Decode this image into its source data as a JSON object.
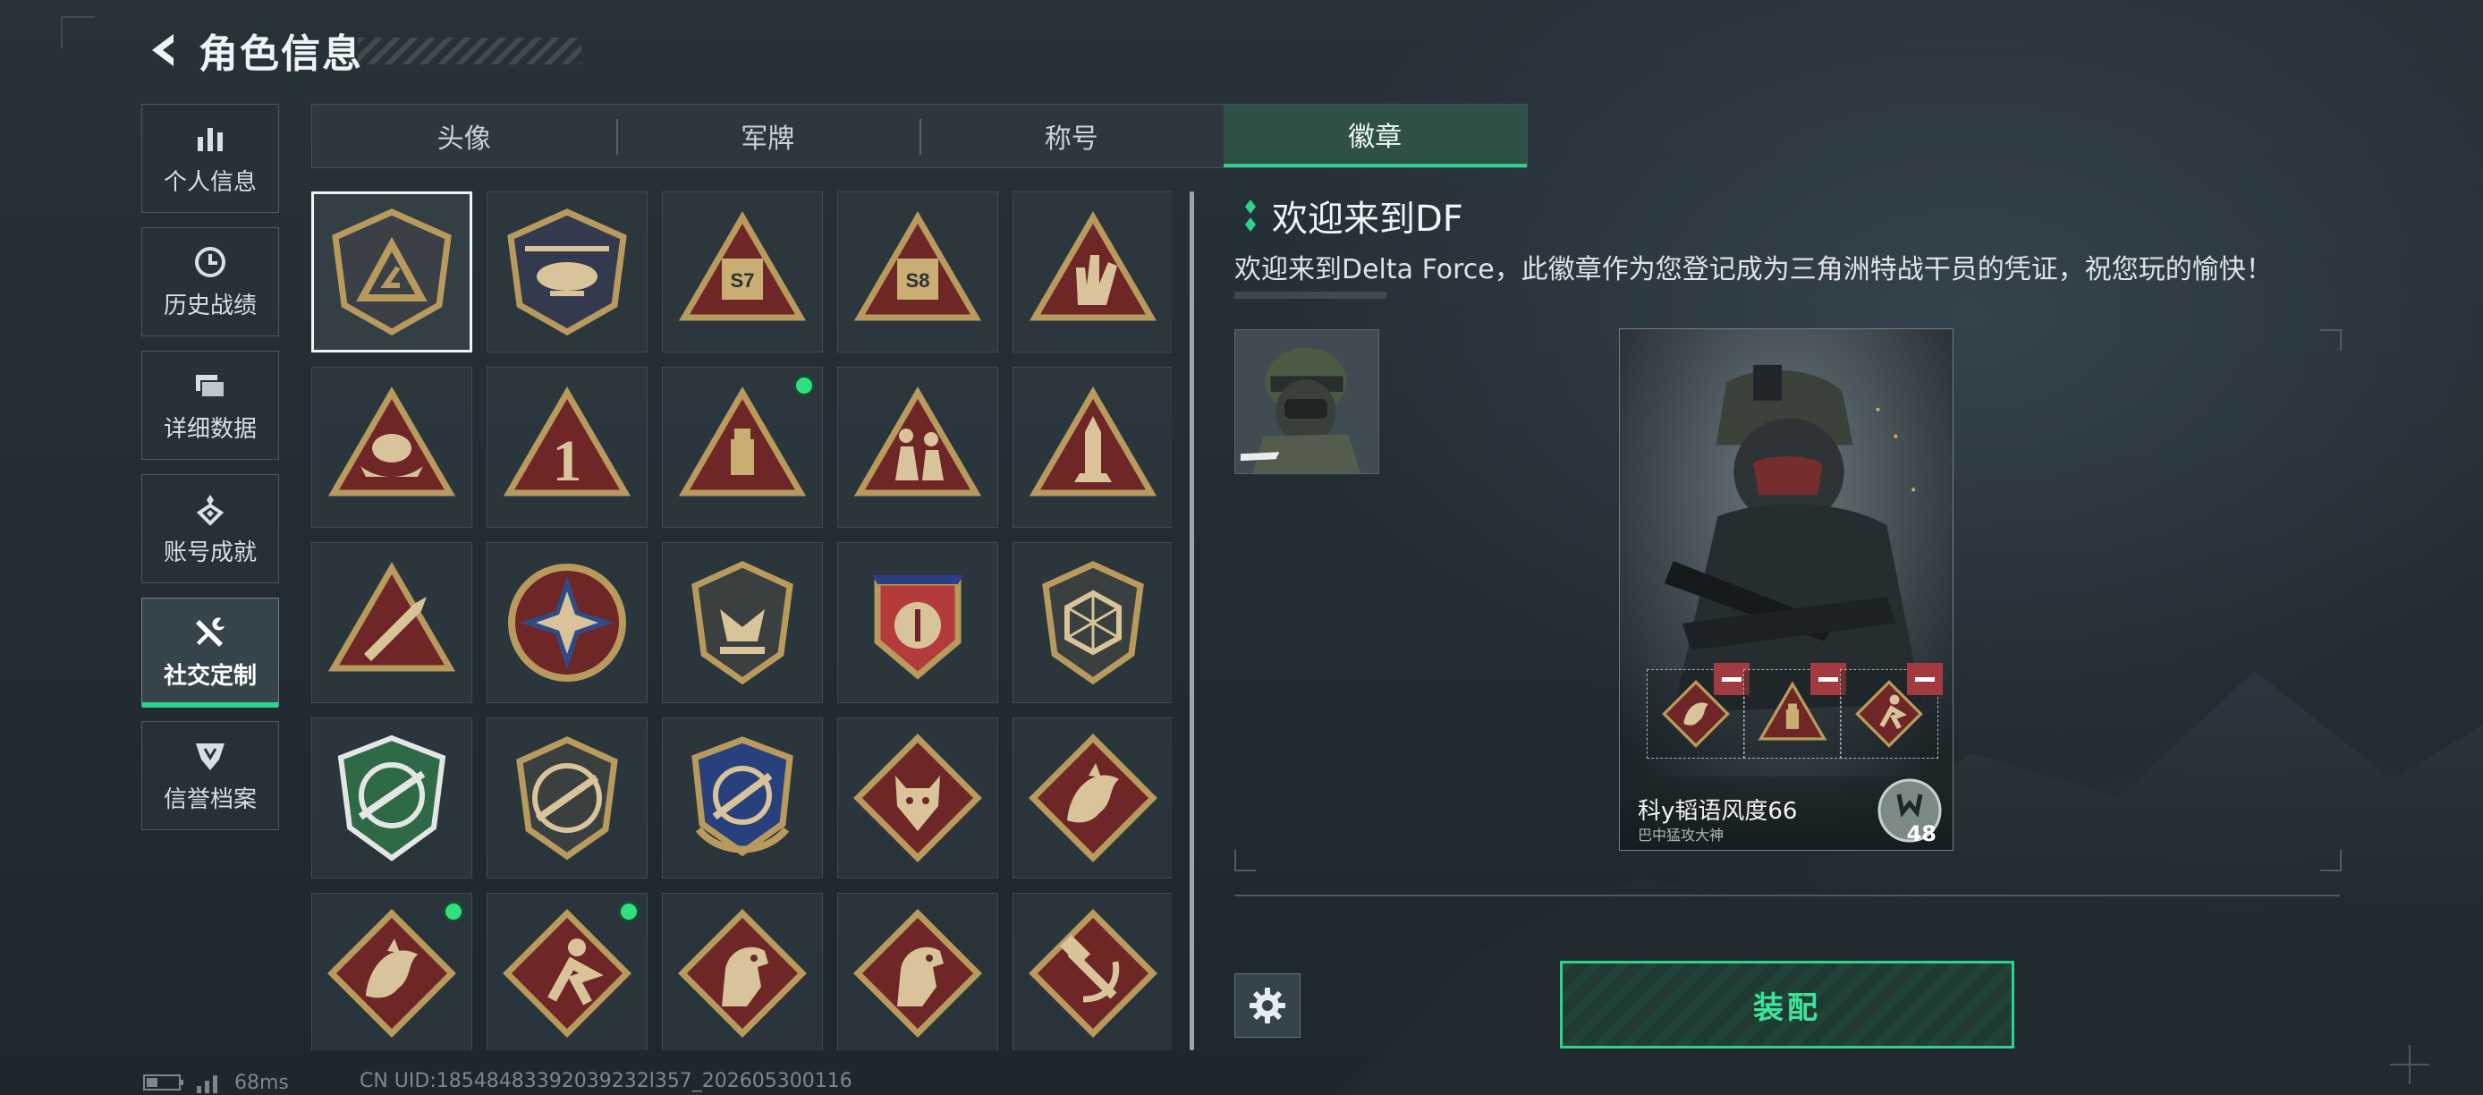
{
  "header": {
    "title": "角色信息",
    "back_icon": "chevron-left-icon"
  },
  "sidebar": {
    "items": [
      {
        "label": "个人信息",
        "icon": "bar-chart-icon",
        "active": false
      },
      {
        "label": "历史战绩",
        "icon": "history-clock-icon",
        "active": false
      },
      {
        "label": "详细数据",
        "icon": "folder-stack-icon",
        "active": false
      },
      {
        "label": "账号成就",
        "icon": "achievement-medal-icon",
        "active": false
      },
      {
        "label": "社交定制",
        "icon": "wrench-screwdriver-icon",
        "active": true
      },
      {
        "label": "信誉档案",
        "icon": "reputation-shield-icon",
        "active": false
      }
    ]
  },
  "tabs": [
    {
      "label": "头像",
      "active": false
    },
    {
      "label": "军牌",
      "active": false
    },
    {
      "label": "称号",
      "active": false
    },
    {
      "label": "徽章",
      "active": true
    }
  ],
  "badges": [
    {
      "icon": "delta-shield-badge-icon",
      "selected": true,
      "is_new": false
    },
    {
      "icon": "helicopter-badge-icon",
      "selected": false,
      "is_new": false
    },
    {
      "icon": "s7-triangle-badge-icon",
      "selected": false,
      "is_new": false,
      "text": "S7"
    },
    {
      "icon": "s8-triangle-badge-icon",
      "selected": false,
      "is_new": false,
      "text": "S8"
    },
    {
      "icon": "hand-sign-badge-icon",
      "selected": false,
      "is_new": false
    },
    {
      "icon": "boat-triangle-badge-icon",
      "selected": false,
      "is_new": false
    },
    {
      "icon": "number-one-badge-icon",
      "selected": false,
      "is_new": false,
      "text": "1"
    },
    {
      "icon": "usb-triangle-badge-icon",
      "selected": false,
      "is_new": true
    },
    {
      "icon": "soldiers-triangle-badge-icon",
      "selected": false,
      "is_new": false
    },
    {
      "icon": "rocket-triangle-badge-icon",
      "selected": false,
      "is_new": false
    },
    {
      "icon": "missile-triangle-badge-icon",
      "selected": false,
      "is_new": false
    },
    {
      "icon": "star-compass-badge-icon",
      "selected": false,
      "is_new": false
    },
    {
      "icon": "eagle-shield-badge-icon",
      "selected": false,
      "is_new": false
    },
    {
      "icon": "stars-crest-badge-icon",
      "selected": false,
      "is_new": false
    },
    {
      "icon": "hexagon-die-badge-icon",
      "selected": false,
      "is_new": false
    },
    {
      "icon": "crosshair-rifle-badge-icon",
      "selected": false,
      "is_new": false
    },
    {
      "icon": "rifle-circle-badge-icon",
      "selected": false,
      "is_new": false
    },
    {
      "icon": "blue-rifle-crest-badge-icon",
      "selected": false,
      "is_new": false
    },
    {
      "icon": "wolf-diamond-badge-icon",
      "selected": false,
      "is_new": false
    },
    {
      "icon": "dragon-diamond-badge-icon",
      "selected": false,
      "is_new": false
    },
    {
      "icon": "dragon-diamond-badge-icon",
      "selected": false,
      "is_new": true
    },
    {
      "icon": "runner-diamond-badge-icon",
      "selected": false,
      "is_new": true
    },
    {
      "icon": "horse-diamond-badge-icon",
      "selected": false,
      "is_new": false
    },
    {
      "icon": "horse-diamond-badge-icon",
      "selected": false,
      "is_new": false
    },
    {
      "icon": "hammer-diamond-badge-icon",
      "selected": false,
      "is_new": false
    }
  ],
  "detail": {
    "title": "欢迎来到DF",
    "description": "欢迎来到Delta Force，此徽章作为您登记成为三角洲特战干员的凭证，祝您玩的愉快！"
  },
  "card": {
    "name": "科y韬语风度66",
    "subtitle": "巴中猛攻大神",
    "rank": "48",
    "slots": [
      {
        "icon": "dragon-diamond-badge-icon"
      },
      {
        "icon": "usb-triangle-badge-icon"
      },
      {
        "icon": "runner-diamond-badge-icon"
      }
    ]
  },
  "actions": {
    "equip_label": "装配",
    "settings_icon": "gear-icon"
  },
  "status_bar": {
    "ping": "68ms",
    "uid": "CN UID:18548483392039232l357_202605300116"
  },
  "colors": {
    "accent": "#2bd38c",
    "new_dot": "#2ee07f",
    "remove": "#a23b3f",
    "badge_gold": "#b99a5d",
    "badge_red": "#7a2a2a"
  }
}
